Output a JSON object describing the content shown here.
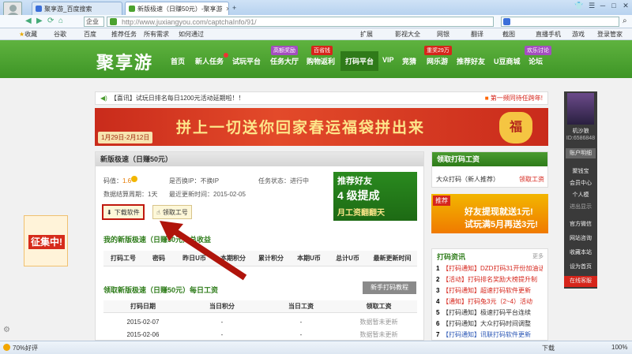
{
  "browser": {
    "tabs": [
      {
        "title": "聚享游_百度搜索"
      },
      {
        "title": "新版极速（日赚50元）-聚享游"
      }
    ],
    "mode_label": "企业",
    "address": "http://www.juxiangyou.com/captchaInfo/91/",
    "bookmarks": [
      "收藏",
      "谷歌",
      "百度",
      "推荐任务",
      "所有需求",
      "如何通过"
    ],
    "right_tools": [
      "扩展",
      "影视大全",
      "网银",
      "翻译",
      "截图",
      "直播手机",
      "游戏",
      "登录管家"
    ],
    "status_left": "70%好评",
    "status_right": [
      "下载",
      "100%"
    ]
  },
  "site": {
    "logo": "聚享游",
    "nav": [
      {
        "label": "首页",
        "active": false
      },
      {
        "label": "新人任务",
        "active": false
      },
      {
        "label": "试玩平台",
        "active": false
      },
      {
        "label": "任务大厅",
        "active": false
      },
      {
        "label": "购物返利",
        "active": false
      },
      {
        "label": "打码平台",
        "active": true
      },
      {
        "label": "VIP",
        "active": false
      },
      {
        "label": "竞猜",
        "active": false
      },
      {
        "label": "网乐游",
        "active": false
      },
      {
        "label": "推荐好友",
        "active": false
      },
      {
        "label": "U豆商城",
        "active": false
      },
      {
        "label": "论坛",
        "active": false
      }
    ],
    "nav_badges": {
      "tasks": "高额奖励",
      "shop": "百省钱",
      "game": "重奖29万",
      "forum": "欢乐讨论"
    },
    "notice": "【喜讯】试玩日排名每日1200元活动延期啦！！",
    "notice_right": "第一频同待任跨年!",
    "banner_title": "拼上一切送你回家春运福袋拼出来",
    "banner_date": "1月29日-2月12日",
    "banner_bag": "福"
  },
  "main": {
    "title": "新版极速（日赚50元）",
    "meta": {
      "price_label": "码值：",
      "price": "1.6",
      "ip_label": "是否换IP：不换IP",
      "status_label": "任务状态：进行中",
      "cycle_label": "数据结算周期：1天",
      "updated_label": "最近更新时间：2015-02-05"
    },
    "download_btn": "下载软件",
    "job_btn": "领取工号",
    "promo": {
      "title": "推荐好友",
      "line1": "4 级提成",
      "line2": "月工资翻翻天"
    },
    "total_title": "我的新版极速（日赚50元）总收益",
    "total_cols": [
      "打码工号",
      "密码",
      "昨日U币",
      "本期积分",
      "累计积分",
      "本期U币",
      "总计U币",
      "最新更新时间"
    ],
    "daily_title": "领取新版极速（日赚50元）每日工资",
    "tutorial_btn": "新手打码教程",
    "daily_cols": [
      "打码日期",
      "当日积分",
      "当日工资",
      "领取工资"
    ],
    "daily_rows": [
      {
        "date": "2015-02-07",
        "points": "-",
        "wage": "-",
        "action": "数据暂未更新"
      },
      {
        "date": "2015-02-06",
        "points": "-",
        "wage": "-",
        "action": "数据暂未更新"
      }
    ]
  },
  "right": {
    "job_title": "领取打码工资",
    "job_item": "大众打码（新人推荐）",
    "job_link": "领取工资",
    "promo_text1": "好友提现就送1元!",
    "promo_text2": "试玩满5月再送3元!",
    "promo_tag": "推荐",
    "news_title": "打码资讯",
    "news_more": "更多",
    "news": [
      "【打码通知】DZD打码31开份加油话",
      "【活动】打码排名奖励大榜提升制",
      "【打码通知】超速打码软件更新",
      "【通知】打码兔3元（2~4）活动",
      "【打码通知】极速打码平台连续",
      "【打码通知】大众打码时间调整",
      "【打码通知】讯联打码软件更新"
    ]
  },
  "sidebar": {
    "user": "机沙狼",
    "id_label": "ID:6586848",
    "account_btn": "账户明细",
    "items": [
      "聚钱宝",
      "会员中心",
      "个人模",
      "进出显示",
      "官方微信",
      "网站咨询",
      "收藏本站",
      "设为首页",
      "在线客服"
    ]
  },
  "left_float": {
    "title": "征集中!"
  }
}
